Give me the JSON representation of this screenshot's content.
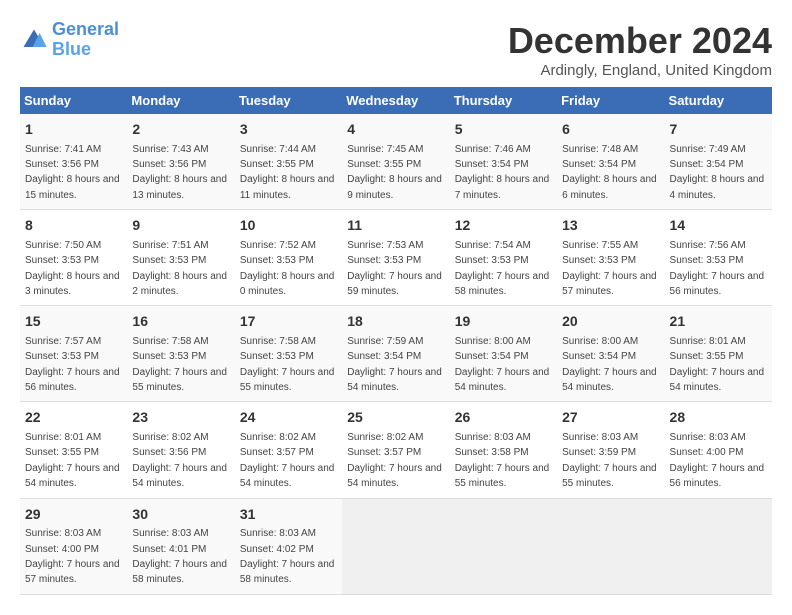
{
  "logo": {
    "line1": "General",
    "line2": "Blue"
  },
  "title": "December 2024",
  "location": "Ardingly, England, United Kingdom",
  "days_header": [
    "Sunday",
    "Monday",
    "Tuesday",
    "Wednesday",
    "Thursday",
    "Friday",
    "Saturday"
  ],
  "weeks": [
    [
      {
        "day": "1",
        "sunrise": "7:41 AM",
        "sunset": "3:56 PM",
        "daylight": "8 hours and 15 minutes."
      },
      {
        "day": "2",
        "sunrise": "7:43 AM",
        "sunset": "3:56 PM",
        "daylight": "8 hours and 13 minutes."
      },
      {
        "day": "3",
        "sunrise": "7:44 AM",
        "sunset": "3:55 PM",
        "daylight": "8 hours and 11 minutes."
      },
      {
        "day": "4",
        "sunrise": "7:45 AM",
        "sunset": "3:55 PM",
        "daylight": "8 hours and 9 minutes."
      },
      {
        "day": "5",
        "sunrise": "7:46 AM",
        "sunset": "3:54 PM",
        "daylight": "8 hours and 7 minutes."
      },
      {
        "day": "6",
        "sunrise": "7:48 AM",
        "sunset": "3:54 PM",
        "daylight": "8 hours and 6 minutes."
      },
      {
        "day": "7",
        "sunrise": "7:49 AM",
        "sunset": "3:54 PM",
        "daylight": "8 hours and 4 minutes."
      }
    ],
    [
      {
        "day": "8",
        "sunrise": "7:50 AM",
        "sunset": "3:53 PM",
        "daylight": "8 hours and 3 minutes."
      },
      {
        "day": "9",
        "sunrise": "7:51 AM",
        "sunset": "3:53 PM",
        "daylight": "8 hours and 2 minutes."
      },
      {
        "day": "10",
        "sunrise": "7:52 AM",
        "sunset": "3:53 PM",
        "daylight": "8 hours and 0 minutes."
      },
      {
        "day": "11",
        "sunrise": "7:53 AM",
        "sunset": "3:53 PM",
        "daylight": "7 hours and 59 minutes."
      },
      {
        "day": "12",
        "sunrise": "7:54 AM",
        "sunset": "3:53 PM",
        "daylight": "7 hours and 58 minutes."
      },
      {
        "day": "13",
        "sunrise": "7:55 AM",
        "sunset": "3:53 PM",
        "daylight": "7 hours and 57 minutes."
      },
      {
        "day": "14",
        "sunrise": "7:56 AM",
        "sunset": "3:53 PM",
        "daylight": "7 hours and 56 minutes."
      }
    ],
    [
      {
        "day": "15",
        "sunrise": "7:57 AM",
        "sunset": "3:53 PM",
        "daylight": "7 hours and 56 minutes."
      },
      {
        "day": "16",
        "sunrise": "7:58 AM",
        "sunset": "3:53 PM",
        "daylight": "7 hours and 55 minutes."
      },
      {
        "day": "17",
        "sunrise": "7:58 AM",
        "sunset": "3:53 PM",
        "daylight": "7 hours and 55 minutes."
      },
      {
        "day": "18",
        "sunrise": "7:59 AM",
        "sunset": "3:54 PM",
        "daylight": "7 hours and 54 minutes."
      },
      {
        "day": "19",
        "sunrise": "8:00 AM",
        "sunset": "3:54 PM",
        "daylight": "7 hours and 54 minutes."
      },
      {
        "day": "20",
        "sunrise": "8:00 AM",
        "sunset": "3:54 PM",
        "daylight": "7 hours and 54 minutes."
      },
      {
        "day": "21",
        "sunrise": "8:01 AM",
        "sunset": "3:55 PM",
        "daylight": "7 hours and 54 minutes."
      }
    ],
    [
      {
        "day": "22",
        "sunrise": "8:01 AM",
        "sunset": "3:55 PM",
        "daylight": "7 hours and 54 minutes."
      },
      {
        "day": "23",
        "sunrise": "8:02 AM",
        "sunset": "3:56 PM",
        "daylight": "7 hours and 54 minutes."
      },
      {
        "day": "24",
        "sunrise": "8:02 AM",
        "sunset": "3:57 PM",
        "daylight": "7 hours and 54 minutes."
      },
      {
        "day": "25",
        "sunrise": "8:02 AM",
        "sunset": "3:57 PM",
        "daylight": "7 hours and 54 minutes."
      },
      {
        "day": "26",
        "sunrise": "8:03 AM",
        "sunset": "3:58 PM",
        "daylight": "7 hours and 55 minutes."
      },
      {
        "day": "27",
        "sunrise": "8:03 AM",
        "sunset": "3:59 PM",
        "daylight": "7 hours and 55 minutes."
      },
      {
        "day": "28",
        "sunrise": "8:03 AM",
        "sunset": "4:00 PM",
        "daylight": "7 hours and 56 minutes."
      }
    ],
    [
      {
        "day": "29",
        "sunrise": "8:03 AM",
        "sunset": "4:00 PM",
        "daylight": "7 hours and 57 minutes."
      },
      {
        "day": "30",
        "sunrise": "8:03 AM",
        "sunset": "4:01 PM",
        "daylight": "7 hours and 58 minutes."
      },
      {
        "day": "31",
        "sunrise": "8:03 AM",
        "sunset": "4:02 PM",
        "daylight": "7 hours and 58 minutes."
      },
      null,
      null,
      null,
      null
    ]
  ]
}
